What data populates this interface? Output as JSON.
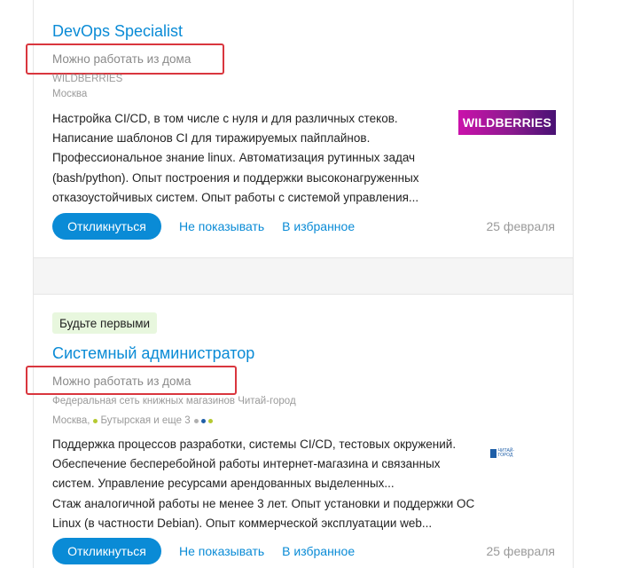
{
  "vacancies": [
    {
      "title": "DevOps Specialist",
      "remote": "Можно работать из дома",
      "company": "WILDBERRIES",
      "city": "Москва",
      "logo_text": "WILDBERRIES",
      "description": [
        "Настройка CI/CD, в том числе с нуля и для различных стеков.",
        "Написание шаблонов CI для тиражируемых пайплайнов.",
        "Профессиональное знание linux. Автоматизация рутинных задач",
        "(bash/python). Опыт построения и поддержки высоконагруженных",
        "отказоустойчивых систем. Опыт работы с системой управления..."
      ],
      "respond_label": "Откликнуться",
      "hide_label": "Не показывать",
      "favorite_label": "В избранное",
      "date": "25 февраля"
    },
    {
      "badge": "Будьте первыми",
      "title": "Системный администратор",
      "remote": "Можно работать из дома",
      "company": "Федеральная сеть книжных магазинов Читай-город",
      "city": "Москва,",
      "metro": "Бутырская и еще 3",
      "logo_text": "ЧИТАЙ-ГОРОД",
      "description": [
        "Поддержка процессов разработки, системы CI/CD, тестовых окружений.",
        "Обеспечение бесперебойной работы интернет-магазина и связанных",
        "систем. Управление ресурсами арендованных выделенных...",
        "Стаж аналогичной работы не менее 3 лет. Опыт установки и поддержки ОС",
        "Linux (в частности Debian). Опыт коммерческой эксплуатации web..."
      ],
      "respond_label": "Откликнуться",
      "hide_label": "Не показывать",
      "favorite_label": "В избранное",
      "date": "25 февраля"
    }
  ],
  "colors": {
    "link": "#0a8bd6",
    "highlight_box": "#d9363e",
    "badge_bg": "#e8f7de",
    "metro_line": "#b5c931",
    "metro_dots": [
      "#b0b0b0",
      "#1f5fa8",
      "#b5c931"
    ]
  }
}
